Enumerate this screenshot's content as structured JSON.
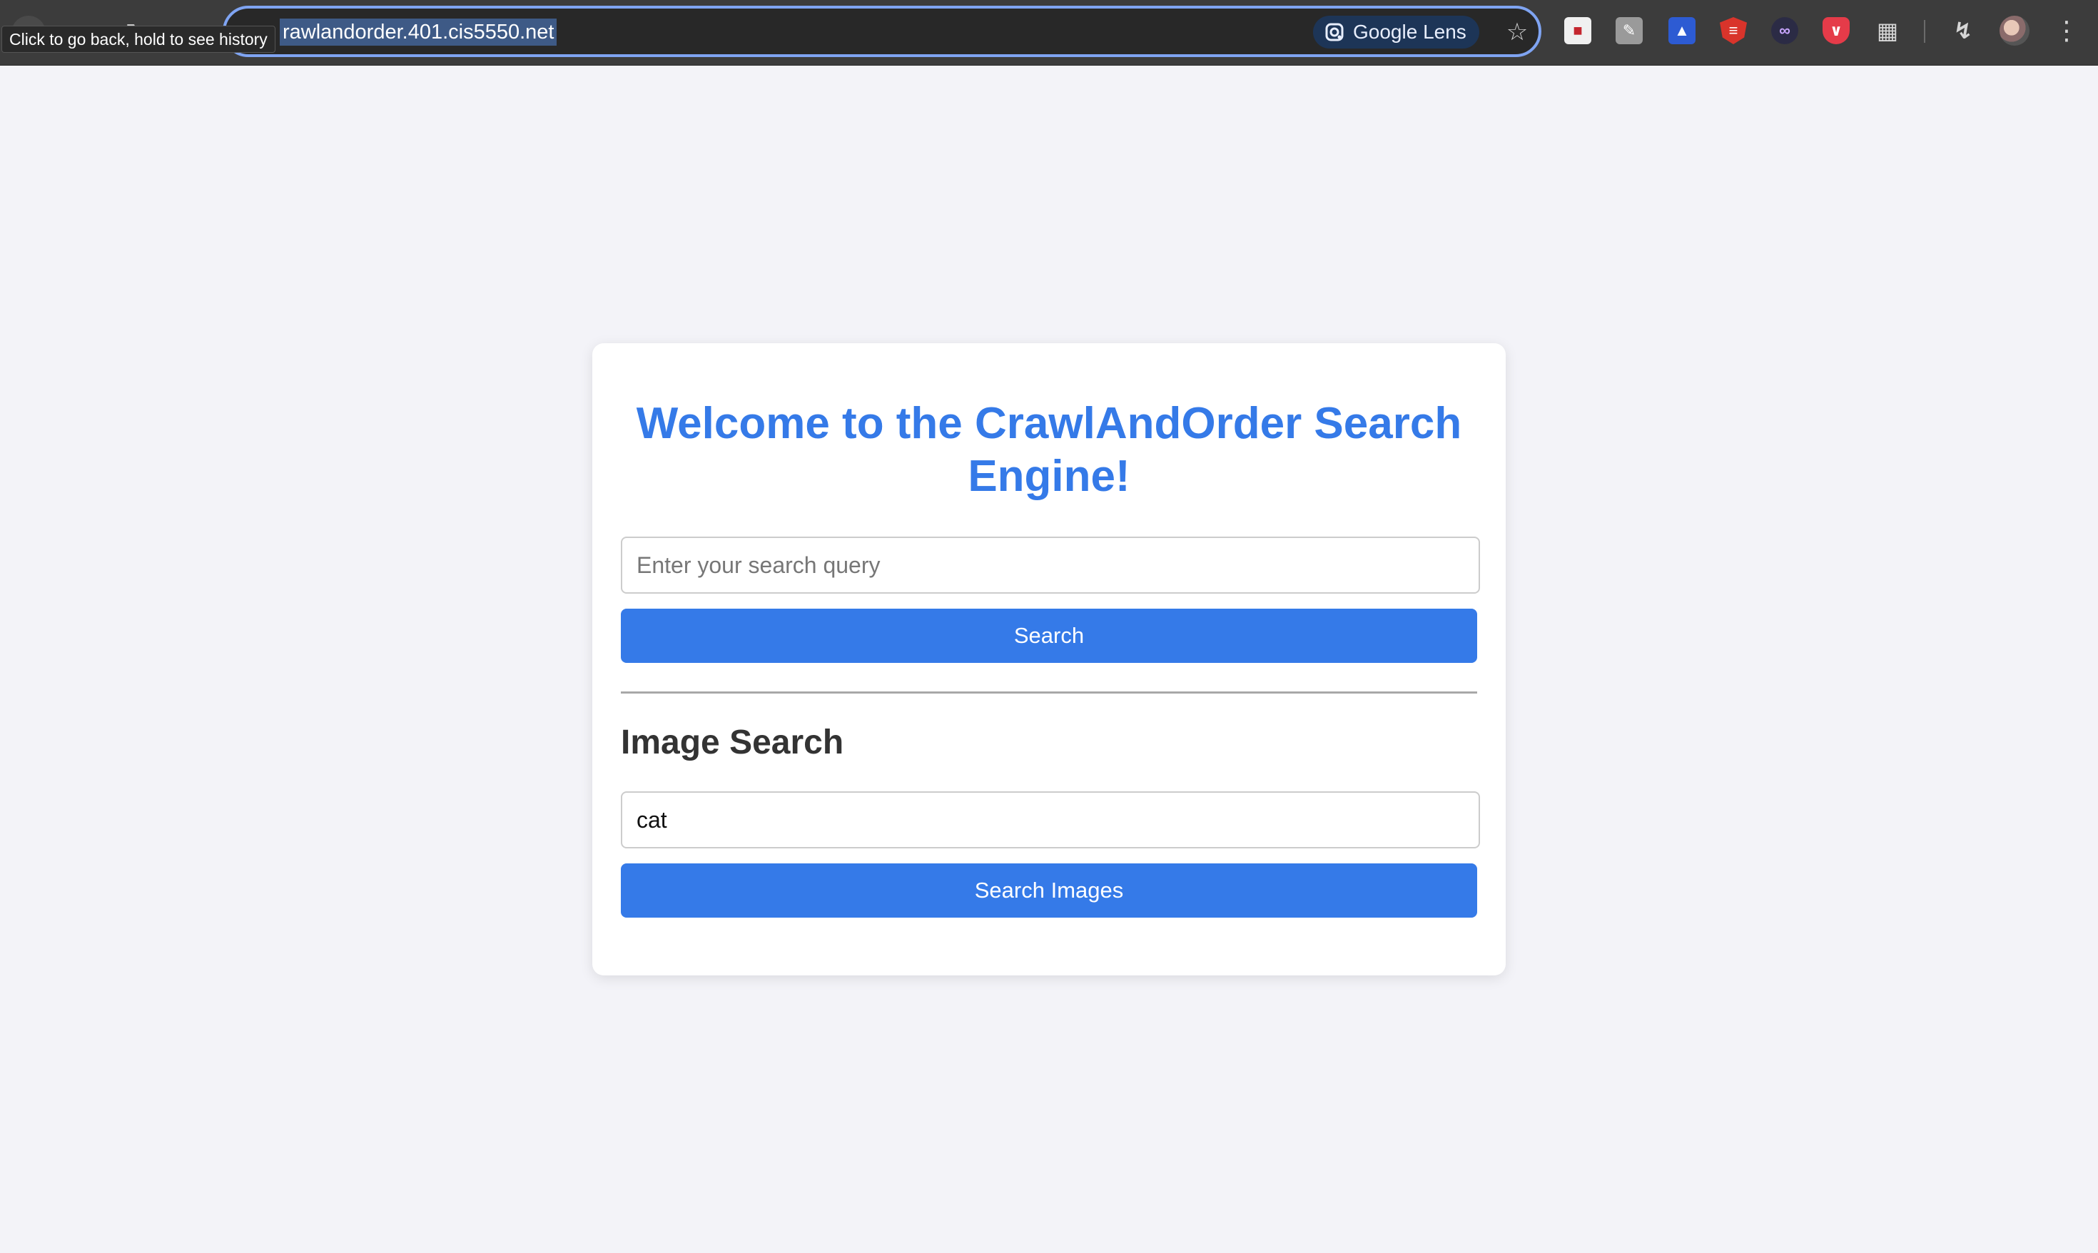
{
  "browser": {
    "tooltip": "Click to go back, hold to see history",
    "url": "rawlandorder.401.cis5550.net",
    "lens_label": "Google Lens",
    "icons": {
      "back": "arrow-left-icon",
      "forward": "arrow-right-icon",
      "reload": "reload-icon",
      "home": "home-icon",
      "site_info": "site-info-icon",
      "bookmark": "star-icon",
      "extensions": "puzzle-icon",
      "menu": "kebab-menu-icon"
    }
  },
  "page": {
    "title": "Welcome to the CrawlAndOrder Search Engine!",
    "search": {
      "placeholder": "Enter your search query",
      "value": "",
      "button_label": "Search"
    },
    "image_search": {
      "heading": "Image Search",
      "value": "cat",
      "button_label": "Search Images"
    }
  },
  "colors": {
    "accent": "#357ae8",
    "page_background": "#f3f3f8",
    "heading_text": "#333333"
  }
}
